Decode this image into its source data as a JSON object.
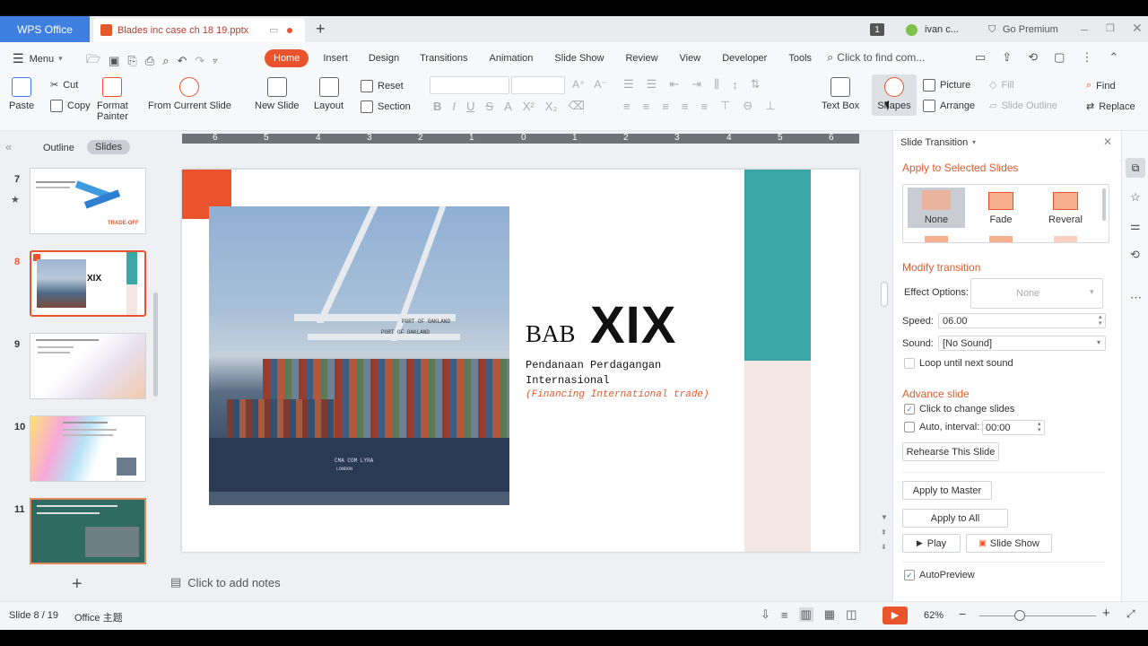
{
  "tabs": {
    "app": "WPS Office",
    "document": "Blades inc case ch 18 19.pptx",
    "user": "ivan c...",
    "premium": "Go Premium",
    "notif_count": "1"
  },
  "menu": {
    "menu_label": "Menu",
    "items": [
      "Home",
      "Insert",
      "Design",
      "Transitions",
      "Animation",
      "Slide Show",
      "Review",
      "View",
      "Developer",
      "Tools"
    ],
    "search": "Click to find com..."
  },
  "ribbon": {
    "paste": "Paste",
    "cut": "Cut",
    "copy": "Copy",
    "format_painter_1": "Format",
    "format_painter_2": "Painter",
    "from_current": "From Current Slide",
    "new_slide": "New Slide",
    "layout": "Layout",
    "reset": "Reset",
    "section": "Section",
    "text_box": "Text Box",
    "shapes": "Shapes",
    "picture": "Picture",
    "arrange": "Arrange",
    "fill": "Fill",
    "slide_outline": "Slide Outline",
    "find": "Find",
    "replace": "Replace"
  },
  "left_panel": {
    "outline_tab": "Outline",
    "slides_tab": "Slides",
    "slides": [
      {
        "num": "7",
        "title": "TRADE-OFF"
      },
      {
        "num": "8",
        "title": "XIX"
      },
      {
        "num": "9",
        "title": ""
      },
      {
        "num": "10",
        "title": ""
      },
      {
        "num": "11",
        "title": ""
      }
    ]
  },
  "slide": {
    "bab": "BAB",
    "numeral": "XIX",
    "subtitle_1": "Pendanaan Perdagangan",
    "subtitle_2": "Internasional",
    "subtitle_3": "(Financing International trade)",
    "sign_1": "PORT OF OAKLAND",
    "sign_2": "PORT OF OAKLAND",
    "ship_name": "CMA CGM LYRA",
    "ship_port": "LONDON",
    "ruler": [
      "6",
      "5",
      "4",
      "3",
      "2",
      "1",
      "0",
      "1",
      "2",
      "3",
      "4",
      "5",
      "6"
    ]
  },
  "notes": {
    "placeholder": "Click to add notes"
  },
  "transition_panel": {
    "title": "Slide Transition",
    "apply_heading": "Apply to Selected Slides",
    "effects": [
      "None",
      "Fade",
      "Reveral"
    ],
    "modify_heading": "Modify transition",
    "effect_options_label": "Effect Options:",
    "effect_options_value": "None",
    "speed_label": "Speed:",
    "speed_value": "06.00",
    "sound_label": "Sound:",
    "sound_value": "[No Sound]",
    "loop_label": "Loop until next sound",
    "advance_heading": "Advance slide",
    "click_label": "Click to change slides",
    "auto_label": "Auto, interval:",
    "auto_value": "00:00",
    "rehearse": "Rehearse This Slide",
    "apply_master": "Apply to Master",
    "apply_all": "Apply to All",
    "play": "Play",
    "slide_show": "Slide Show",
    "autopreview": "AutoPreview"
  },
  "status": {
    "slide_info": "Slide 8 / 19",
    "theme": "Office 主题",
    "zoom": "62%"
  },
  "colors": {
    "accent": "#e9542d",
    "teal": "#3aa6a5",
    "wps_blue": "#3f7fe0",
    "pink": "#f4e6e2"
  }
}
